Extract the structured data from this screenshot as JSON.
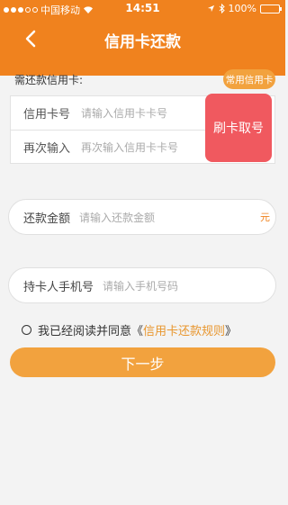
{
  "status_bar": {
    "carrier": "中国移动",
    "time": "14:51",
    "battery": "100%"
  },
  "nav": {
    "title": "信用卡还款"
  },
  "card_section": {
    "label": "需还款信用卡:",
    "common_card_button": "常用信用卡",
    "card_number_label": "信用卡号",
    "card_number_placeholder": "请输入信用卡卡号",
    "reenter_label": "再次输入",
    "reenter_placeholder": "再次输入信用卡卡号",
    "swipe_button": "刷卡取号"
  },
  "amount_field": {
    "label": "还款金额",
    "placeholder": "请输入还款金额",
    "unit": "元"
  },
  "phone_field": {
    "label": "持卡人手机号",
    "placeholder": "请输入手机号码"
  },
  "agreement": {
    "text": "我已经阅读并同意《",
    "link": "信用卡还款规则",
    "close": "》"
  },
  "next_button": "下一步",
  "colors": {
    "brand": "#f0821e",
    "button": "#f2a23e",
    "swipe": "#f0595f"
  }
}
